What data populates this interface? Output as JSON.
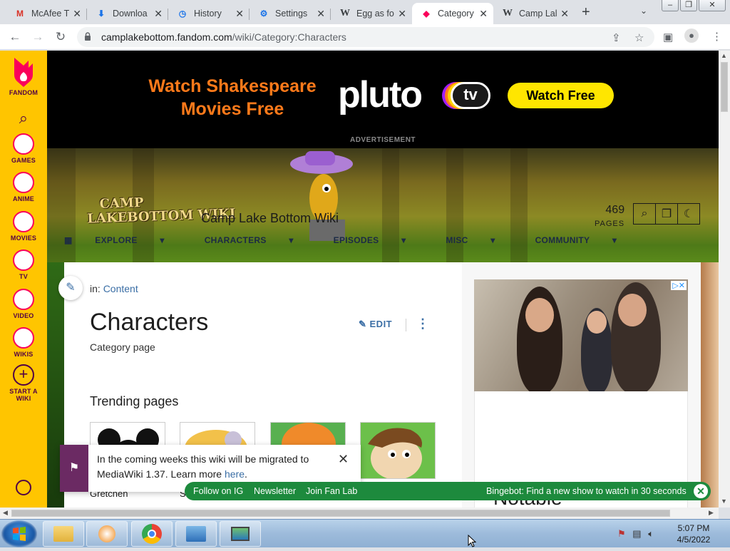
{
  "tabs": [
    {
      "title": "McAfee T",
      "icon": "gmail-icon",
      "active": false
    },
    {
      "title": "Downloa",
      "icon": "download-icon",
      "active": false
    },
    {
      "title": "History",
      "icon": "history-icon",
      "active": false
    },
    {
      "title": "Settings",
      "icon": "gear-icon",
      "active": false
    },
    {
      "title": "Egg as fo",
      "icon": "wikipedia-icon",
      "active": false
    },
    {
      "title": "Category",
      "icon": "fandom-icon",
      "active": true
    },
    {
      "title": "Camp Lal",
      "icon": "wikipedia-icon",
      "active": false
    }
  ],
  "address": {
    "host": "camplakebottom.fandom.com",
    "path": "/wiki/Category:Characters"
  },
  "fandom_sidebar": {
    "brand": "FANDOM",
    "items": [
      {
        "label": "GAMES",
        "icon": "games-icon"
      },
      {
        "label": "ANIME",
        "icon": "anime-icon"
      },
      {
        "label": "MOVIES",
        "icon": "movies-icon"
      },
      {
        "label": "TV",
        "icon": "tv-icon"
      },
      {
        "label": "VIDEO",
        "icon": "video-icon"
      },
      {
        "label": "WIKIS",
        "icon": "wikis-icon"
      }
    ],
    "start_wiki_line1": "START A",
    "start_wiki_line2": "WIKI"
  },
  "ad": {
    "headline_line1": "Watch Shakespeare",
    "headline_line2": "Movies Free",
    "brand": "pluto",
    "brand_suffix": "tv",
    "cta": "Watch Free",
    "label": "ADVERTISEMENT",
    "colors": {
      "headline": "#ff7a1a",
      "cta": "#ffe600"
    }
  },
  "wiki": {
    "logo_line1": "CAMP",
    "logo_line2": "LAKEBOTTOM WIKI",
    "title": "Camp Lake Bottom Wiki",
    "page_count": "469",
    "page_count_label": "PAGES",
    "nav": [
      "EXPLORE",
      "CHARACTERS",
      "EPISODES",
      "MISC",
      "COMMUNITY"
    ]
  },
  "article": {
    "crumb_prefix": "in:",
    "crumb_link": "Content",
    "title": "Characters",
    "subtitle": "Category page",
    "edit_label": "EDIT",
    "trending_heading": "Trending pages",
    "thumbs": [
      {
        "caption": "Gretchen"
      },
      {
        "caption": "S"
      },
      {
        "caption": ""
      },
      {
        "caption": ""
      }
    ]
  },
  "rail": {
    "notable_heading": "Notable"
  },
  "notice": {
    "text": "In the coming weeks this wiki will be migrated to MediaWiki 1.37. Learn more ",
    "link": "here",
    "end": "."
  },
  "greenbar": {
    "follow": "Follow on IG",
    "newsletter": "Newsletter",
    "fanlab": "Join Fan Lab",
    "promo": "Bingebot: Find a new show to watch in 30 seconds"
  },
  "taskbar": {
    "time": "5:07 PM",
    "date": "4/5/2022"
  },
  "colors": {
    "fandom_yellow": "#ffc500",
    "fandom_pink": "#fa005a",
    "link": "#3a6ea5",
    "green_bar": "#1d8a3d"
  }
}
